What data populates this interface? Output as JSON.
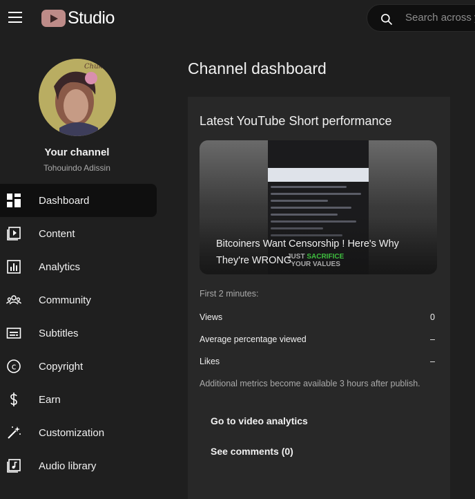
{
  "header": {
    "logo_text": "Studio",
    "search_placeholder": "Search across y"
  },
  "sidebar": {
    "channel_label": "Your channel",
    "channel_name": "Tohouindo Adissin",
    "items": [
      {
        "label": "Dashboard",
        "icon": "dashboard-icon",
        "active": true
      },
      {
        "label": "Content",
        "icon": "content-icon"
      },
      {
        "label": "Analytics",
        "icon": "analytics-icon"
      },
      {
        "label": "Community",
        "icon": "community-icon"
      },
      {
        "label": "Subtitles",
        "icon": "subtitles-icon"
      },
      {
        "label": "Copyright",
        "icon": "copyright-icon"
      },
      {
        "label": "Earn",
        "icon": "dollar-icon"
      },
      {
        "label": "Customization",
        "icon": "magic-wand-icon"
      },
      {
        "label": "Audio library",
        "icon": "audio-library-icon"
      }
    ]
  },
  "main": {
    "title": "Channel dashboard",
    "card": {
      "title": "Latest YouTube Short performance",
      "video_title": "Bitcoiners Want Censorship ! Here's Why They're WRONG",
      "thumb_overlay": "JUST SACRIFICE YOUR VALUES",
      "first_minutes_label": "First 2 minutes:",
      "metrics": [
        {
          "label": "Views",
          "value": "0"
        },
        {
          "label": "Average percentage viewed",
          "value": "–"
        },
        {
          "label": "Likes",
          "value": "–"
        }
      ],
      "note": "Additional metrics become available 3 hours after publish.",
      "analytics_button": "Go to video analytics",
      "comments_button": "See comments (0)"
    }
  }
}
